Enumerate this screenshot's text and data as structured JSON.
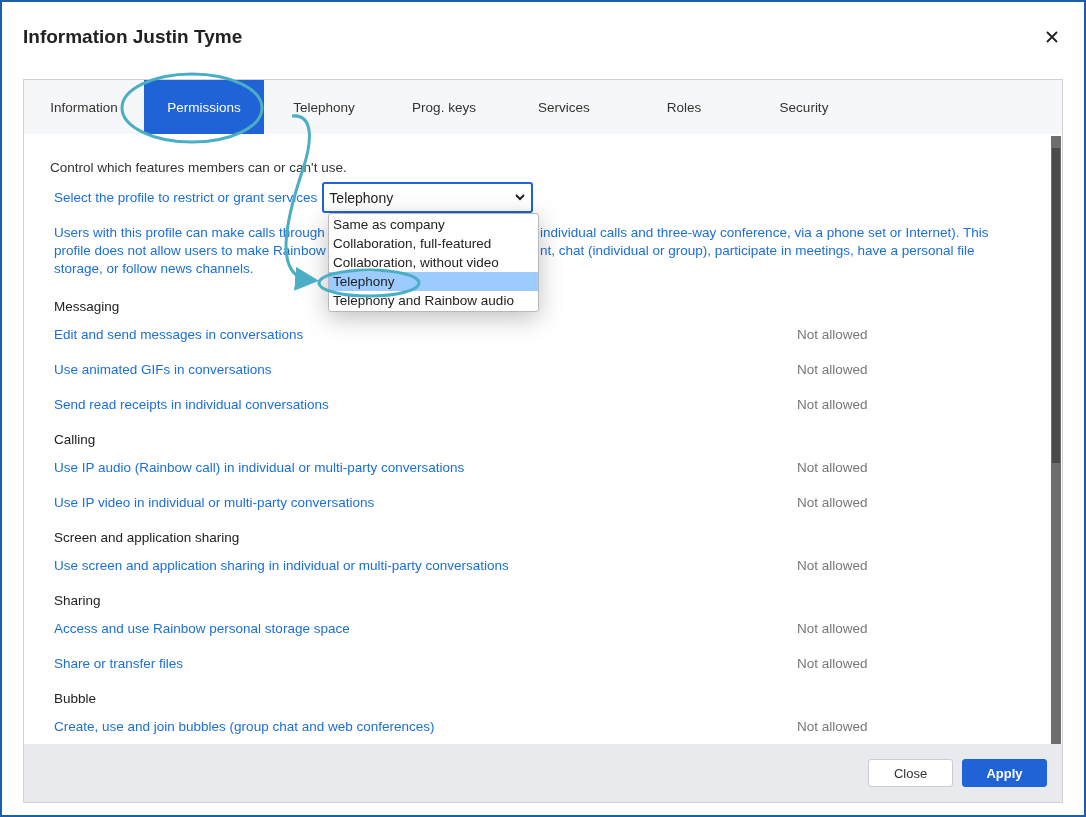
{
  "dialog": {
    "title": "Information Justin Tyme"
  },
  "tabs": [
    {
      "label": "Information",
      "selected": false
    },
    {
      "label": "Permissions",
      "selected": true
    },
    {
      "label": "Telephony",
      "selected": false
    },
    {
      "label": "Prog. keys",
      "selected": false
    },
    {
      "label": "Services",
      "selected": false
    },
    {
      "label": "Roles",
      "selected": false
    },
    {
      "label": "Security",
      "selected": false
    }
  ],
  "intro": "Control which features members can or can't use.",
  "profile": {
    "label": "Select the profile to restrict or grant services",
    "value": "Telephony",
    "options": [
      {
        "label": "Same as company",
        "selected": false
      },
      {
        "label": "Collaboration, full-featured",
        "selected": false
      },
      {
        "label": "Collaboration, without video",
        "selected": false
      },
      {
        "label": "Telephony",
        "selected": true
      },
      {
        "label": "Telephony and Rainbow audio",
        "selected": false
      }
    ]
  },
  "description_lines": [
    {
      "left": "Users with this profile can make calls through",
      "right": "individual calls and three-way conference, via a phone set or Internet). This"
    },
    {
      "left": "profile does not allow users to make Rainbow",
      "right": "nt, chat (individual or group), participate in meetings, have a personal file"
    },
    {
      "left": "storage, or follow news channels."
    }
  ],
  "rows": [
    {
      "kind": "section",
      "label": "Messaging"
    },
    {
      "kind": "permission",
      "label": "Edit and send messages in conversations",
      "status": "Not allowed"
    },
    {
      "kind": "permission",
      "label": "Use animated GIFs in conversations",
      "status": "Not allowed"
    },
    {
      "kind": "permission",
      "label": "Send read receipts in individual conversations",
      "status": "Not allowed"
    },
    {
      "kind": "section",
      "label": "Calling"
    },
    {
      "kind": "permission",
      "label": "Use IP audio (Rainbow call) in individual or multi-party conversations",
      "status": "Not allowed"
    },
    {
      "kind": "permission",
      "label": "Use IP video in individual or multi-party conversations",
      "status": "Not allowed"
    },
    {
      "kind": "section",
      "label": "Screen and application sharing"
    },
    {
      "kind": "permission",
      "label": "Use screen and application sharing in individual or multi-party conversations",
      "status": "Not allowed"
    },
    {
      "kind": "section",
      "label": "Sharing"
    },
    {
      "kind": "permission",
      "label": "Access and use Rainbow personal storage space",
      "status": "Not allowed"
    },
    {
      "kind": "permission",
      "label": "Share or transfer files",
      "status": "Not allowed"
    },
    {
      "kind": "section",
      "label": "Bubble"
    },
    {
      "kind": "permission",
      "label": "Create, use and join bubbles (group chat and web conferences)",
      "status": "Not allowed"
    }
  ],
  "buttons": [
    {
      "label": "Close",
      "kind": "secondary"
    },
    {
      "label": "Apply",
      "kind": "primary"
    }
  ]
}
